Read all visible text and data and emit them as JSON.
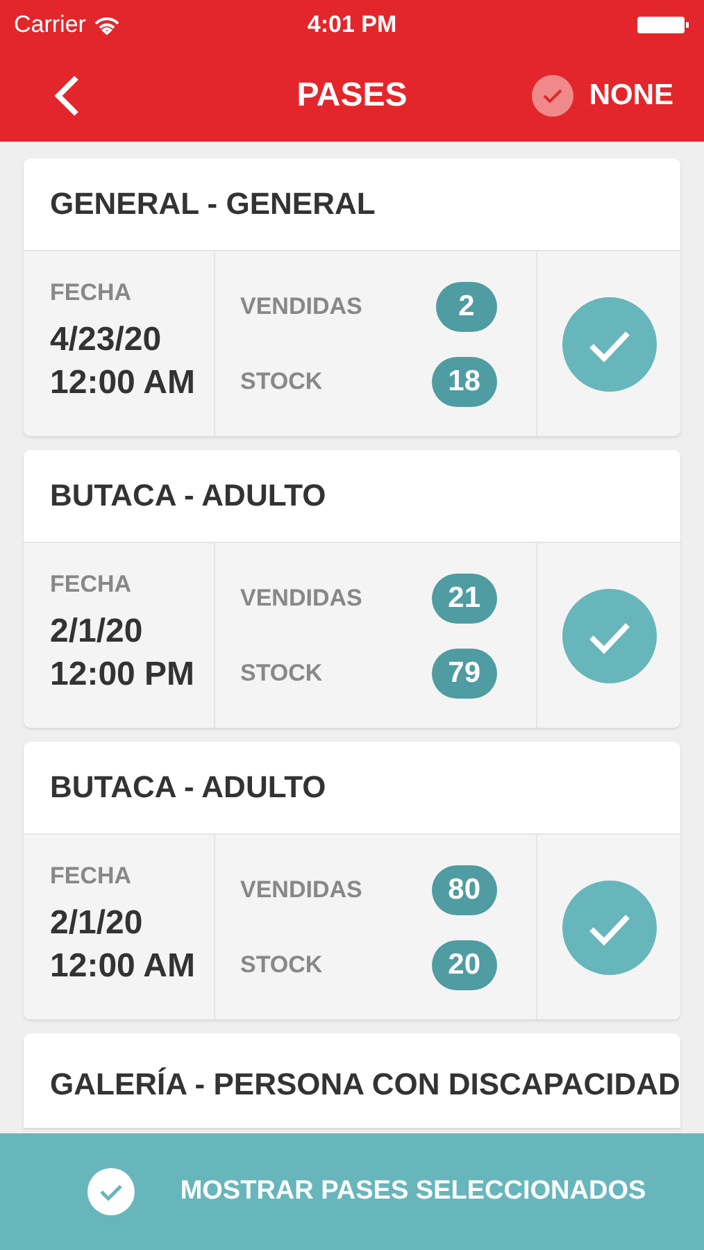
{
  "status_bar": {
    "carrier": "Carrier",
    "time": "4:01 PM"
  },
  "nav": {
    "title": "PASES",
    "action": {
      "label": "NONE",
      "checked": false
    }
  },
  "passes": [
    {
      "title": "GENERAL - GENERAL",
      "date_label": "FECHA",
      "date": "4/23/20",
      "time": "12:00 AM",
      "sold_label": "VENDIDAS",
      "sold": "2",
      "stock_label": "STOCK",
      "stock": "18",
      "selected": true
    },
    {
      "title": "BUTACA - ADULTO",
      "date_label": "FECHA",
      "date": "2/1/20",
      "time": "12:00 PM",
      "sold_label": "VENDIDAS",
      "sold": "21",
      "stock_label": "STOCK",
      "stock": "79",
      "selected": true
    },
    {
      "title": "BUTACA - ADULTO",
      "date_label": "FECHA",
      "date": "2/1/20",
      "time": "12:00 AM",
      "sold_label": "VENDIDAS",
      "sold": "80",
      "stock_label": "STOCK",
      "stock": "20",
      "selected": true
    },
    {
      "title": "GALERÍA - PERSONA CON DISCAPACIDAD"
    }
  ],
  "footer": {
    "label": "MOSTRAR PASES SELECCIONADOS"
  }
}
